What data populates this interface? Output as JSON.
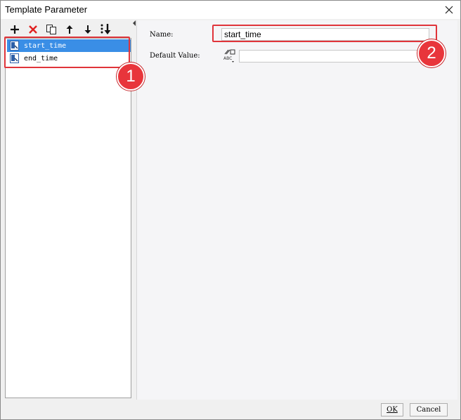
{
  "window": {
    "title": "Template Parameter"
  },
  "toolbar": {
    "buttons": [
      {
        "icon": "plus-icon"
      },
      {
        "icon": "delete-icon"
      },
      {
        "icon": "copy-icon"
      },
      {
        "icon": "arrow-up-icon"
      },
      {
        "icon": "arrow-down-icon"
      },
      {
        "icon": "sort-icon"
      }
    ]
  },
  "tree": {
    "items": [
      {
        "label": "start_time",
        "selected": true
      },
      {
        "label": "end_time",
        "selected": false
      }
    ]
  },
  "form": {
    "name_label": "Name:",
    "name_value": "start_time",
    "default_label": "Default Value:",
    "default_value": ""
  },
  "footer": {
    "ok_label": "OK",
    "cancel_label": "Cancel"
  },
  "annotations": {
    "badge1": "1",
    "badge2": "2",
    "color": "#e0343a"
  },
  "colors": {
    "selection": "#3a8ee6",
    "panel_bg": "#f0f0f0"
  }
}
